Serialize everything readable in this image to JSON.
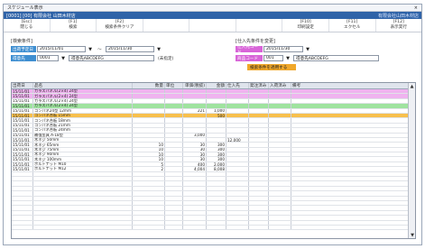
{
  "window": {
    "title": "スケジュール表示",
    "close": "×"
  },
  "header": {
    "left": "[0001] [00] 有限会社 山田木材店",
    "right": "有限会社山田木材店"
  },
  "fkeys": [
    {
      "key": "[Esc]",
      "label": "閉じる"
    },
    {
      "key": "[F1]",
      "label": "検索"
    },
    {
      "key": "[F2]",
      "label": "検索条件クリア"
    },
    {
      "key": "",
      "label": ""
    },
    {
      "key": "",
      "label": ""
    },
    {
      "key": "",
      "label": ""
    },
    {
      "key": "[F10]",
      "label": "印刷設定"
    },
    {
      "key": "[F11]",
      "label": "エクセル"
    },
    {
      "key": "[F12]",
      "label": "表示実行"
    }
  ],
  "search_left": {
    "heading": "[検索条件]",
    "date_label": "出荷予定日",
    "date_from": "2015/11/01",
    "tilde": "～",
    "date_to": "2015/11/30",
    "customer_label": "得意先",
    "customer_code": "0001",
    "customer_name": "得意先ABCDEFG",
    "customer_hint": "(未指定)"
  },
  "search_right": {
    "heading": "[仕入先条件を変更]",
    "supplier_label": "仕入先コード",
    "supplier_value": "2015/11/30",
    "item_label": "商品コード",
    "item_code": "001",
    "item_name": "得意先ABCDEFG",
    "apply_button": "検索条件を適用する"
  },
  "grid": {
    "columns": [
      "出荷日",
      "品名",
      "数量",
      "単位",
      "単価(税抜)",
      "金額",
      "仕入先",
      "発注済み",
      "入荷済み",
      "備考"
    ],
    "rows": [
      {
        "c": [
          "15/11/01",
          "ガラスパネル(2×4) 24型",
          "",
          "",
          "",
          "",
          "",
          "",
          "",
          ""
        ],
        "style": "row-pink"
      },
      {
        "c": [
          "15/11/01",
          "ガラスパネル(2×4) 24型",
          "",
          "",
          "",
          "",
          "",
          "",
          "",
          ""
        ],
        "style": "row-pink"
      },
      {
        "c": [
          "15/11/01",
          "ガラスパネル(2×4) 24型",
          "",
          "",
          "",
          "",
          "",
          "",
          "",
          ""
        ],
        "style": ""
      },
      {
        "c": [
          "15/11/01",
          "ガラスパネル(2×4) 24型",
          "",
          "",
          "",
          "",
          "",
          "",
          "",
          ""
        ],
        "style": "row-green"
      },
      {
        "c": [
          "15/11/01",
          "コンパネ24型 12mm",
          "",
          "",
          "221",
          "1,000",
          "",
          "",
          "",
          ""
        ],
        "style": ""
      },
      {
        "c": [
          "15/11/01",
          "コンパネ合板 15mm",
          "",
          "",
          "",
          "500",
          "",
          "",
          "",
          ""
        ],
        "style": "row-orange"
      },
      {
        "c": [
          "15/11/01",
          "コンパネ合板 18mm",
          "",
          "",
          "",
          "",
          "",
          "",
          "",
          ""
        ],
        "style": ""
      },
      {
        "c": [
          "15/11/01",
          "コンパネ合板 21mm",
          "",
          "",
          "",
          "",
          "",
          "",
          "",
          ""
        ],
        "style": ""
      },
      {
        "c": [
          "15/11/01",
          "コンパネ合板 24mm",
          "",
          "",
          "",
          "",
          "",
          "",
          "",
          ""
        ],
        "style": ""
      },
      {
        "c": [
          "15/11/01",
          "補強金具 A-18型",
          "",
          "",
          "3,000",
          "",
          "",
          "",
          "",
          ""
        ],
        "style": ""
      },
      {
        "c": [
          "15/11/01",
          "木ネジ 50mm",
          "",
          "",
          "",
          "",
          "12,000",
          "",
          "",
          ""
        ],
        "style": ""
      },
      {
        "c": [
          "15/11/01",
          "木ネジ 65mm",
          "10",
          "",
          "30",
          "300",
          "",
          "",
          "",
          ""
        ],
        "style": ""
      },
      {
        "c": [
          "15/11/01",
          "木ネジ 75mm",
          "10",
          "",
          "30",
          "300",
          "",
          "",
          "",
          ""
        ],
        "style": ""
      },
      {
        "c": [
          "15/11/01",
          "木ネジ 90mm",
          "10",
          "",
          "30",
          "300",
          "",
          "",
          "",
          ""
        ],
        "style": ""
      },
      {
        "c": [
          "15/11/01",
          "木ネジ 100mm",
          "10",
          "",
          "30",
          "300",
          "",
          "",
          "",
          ""
        ],
        "style": ""
      },
      {
        "c": [
          "15/11/01",
          "ボルトナット M10",
          "5",
          "",
          "400",
          "2,000",
          "",
          "",
          "",
          ""
        ],
        "style": ""
      },
      {
        "c": [
          "15/11/01",
          "ボルトナット M12",
          "2",
          "",
          "4,004",
          "8,008",
          "",
          "",
          "",
          ""
        ],
        "style": ""
      }
    ]
  },
  "colors": {
    "header_blue": "#2f63a8",
    "label_blue": "#3f8fd1",
    "label_pink": "#d865d8",
    "label_orange": "#f0a82b",
    "row_pink": "#efb3ef",
    "row_green": "#9fe39f",
    "row_orange": "#f7c04d"
  },
  "icons": {
    "dropdown": "chevron-down-icon",
    "scroll_up": "arrow-up-icon",
    "scroll_down": "arrow-down-icon",
    "close": "close-icon"
  }
}
